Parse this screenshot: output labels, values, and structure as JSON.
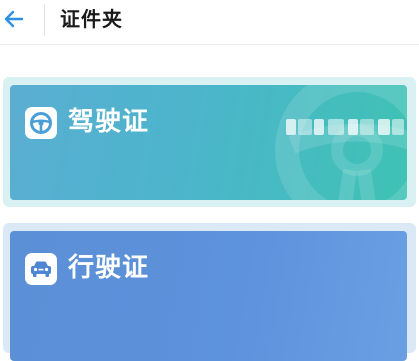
{
  "header": {
    "title": "证件夹",
    "back_icon": "arrow-left-icon"
  },
  "cards": [
    {
      "label": "驾驶证",
      "icon": "steering-wheel-icon",
      "colors": [
        "#5aaed2",
        "#3fc2b4"
      ]
    },
    {
      "label": "行驶证",
      "icon": "car-icon",
      "colors": [
        "#5b8fd6",
        "#6a9fe3"
      ]
    }
  ],
  "colors": {
    "accent": "#2f8fe6",
    "title_text": "#1a1a1a"
  }
}
